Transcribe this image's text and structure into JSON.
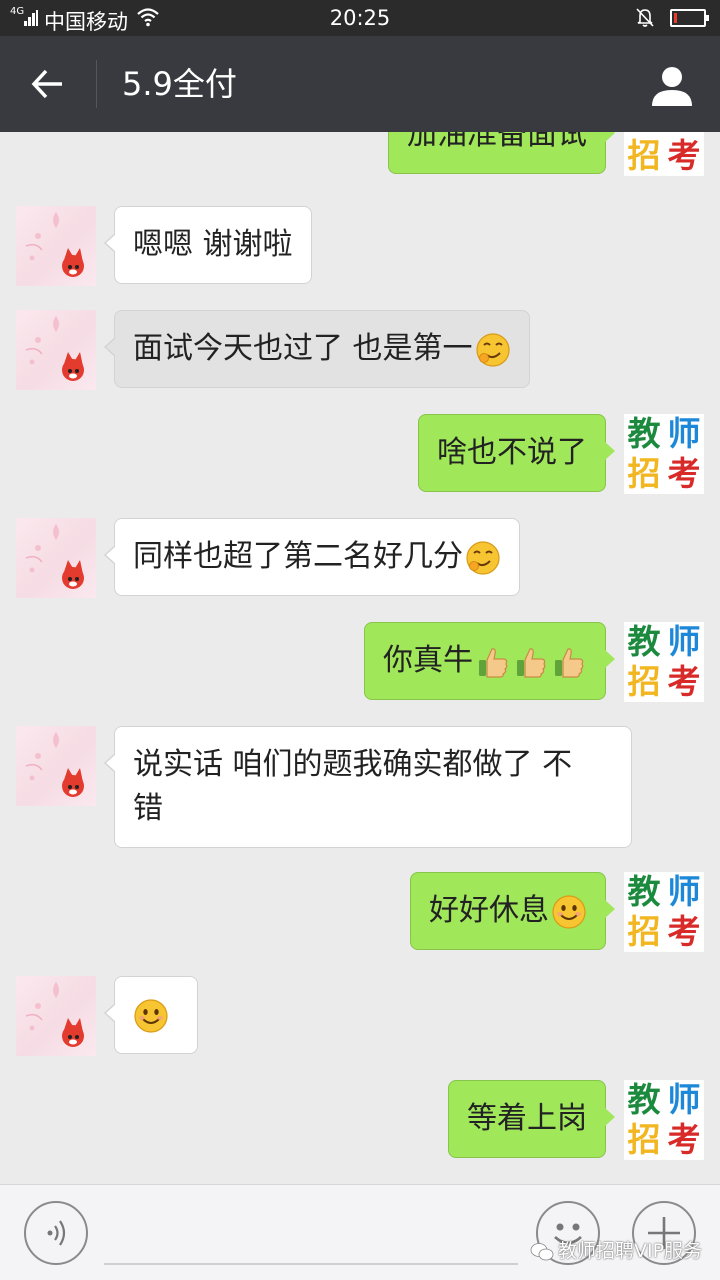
{
  "status_bar": {
    "network": "4G",
    "carrier": "中国移动",
    "time": "20:25",
    "battery_level": 0.1
  },
  "header": {
    "title": "5.9全付"
  },
  "logo_chars": [
    "教",
    "师",
    "招",
    "考"
  ],
  "messages": [
    {
      "side": "right",
      "text": "加油准备面试"
    },
    {
      "side": "left",
      "text": "嗯嗯 谢谢啦"
    },
    {
      "side": "left",
      "text": "面试今天也过了 也是第一",
      "emoji": "smirk-emoji",
      "highlighted": true
    },
    {
      "side": "right",
      "text": "啥也不说了"
    },
    {
      "side": "left",
      "text": "同样也超了第二名好几分",
      "emoji": "smirk-emoji"
    },
    {
      "side": "right",
      "text": "你真牛",
      "emoji": "thumbs-up-emoji",
      "emoji_count": 3
    },
    {
      "side": "left",
      "text_line1": "说实话 咱们的题我确实都做了 不",
      "text_line2": "错"
    },
    {
      "side": "right",
      "text": "好好休息",
      "emoji": "smile-emoji"
    },
    {
      "side": "left",
      "emoji": "smile-emoji"
    },
    {
      "side": "right",
      "text": "等着上岗"
    }
  ],
  "watermark": {
    "text": "教师招聘VIP服务"
  },
  "colors": {
    "bubble_sent": "#a0e75a",
    "bubble_received": "#ffffff",
    "title_bar": "#393a3f"
  }
}
